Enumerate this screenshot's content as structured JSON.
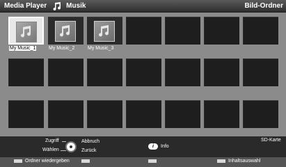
{
  "header": {
    "title": "Media Player",
    "subtitle": "Musik",
    "right_label": "Bild-Ordner"
  },
  "grid": {
    "folders": [
      {
        "label": "My Music_1",
        "selected": true
      },
      {
        "label": "My Music_2",
        "selected": false
      },
      {
        "label": "My Music_3",
        "selected": false
      }
    ]
  },
  "footer": {
    "zugriff": "Zugriff",
    "waehlen": "Wählen",
    "abbruch": "Abbruch",
    "zurueck": "Zurück",
    "info_glyph": "i",
    "info": "Info",
    "sd_card": "SD-Karte",
    "ordner_wiedergeben": "Ordner wiedergeben",
    "inhaltsauswahl": "Inhaltsauswahl"
  },
  "icons": {
    "header_music": "music-note-icon",
    "folder": "music-folder-icon",
    "nav": "navigation-ring-icon",
    "info": "info-icon"
  }
}
